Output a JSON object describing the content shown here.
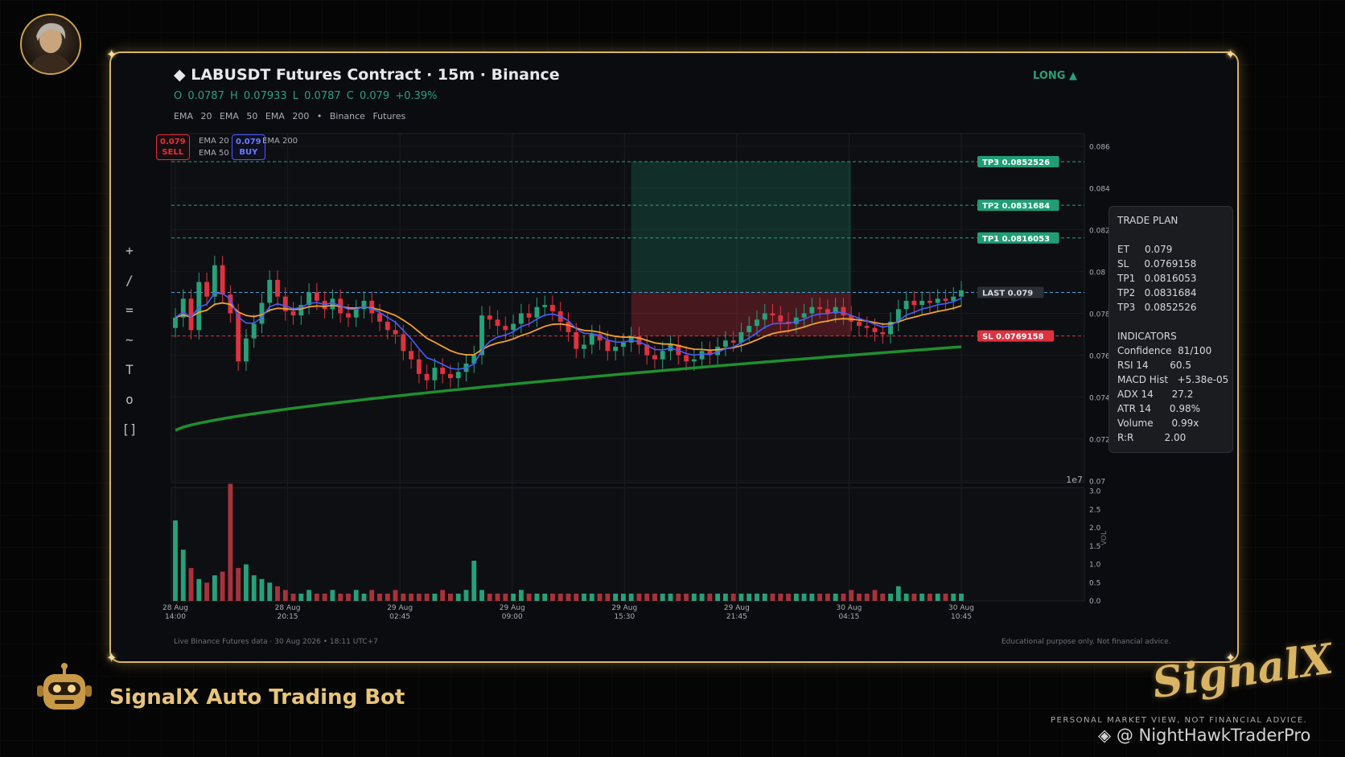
{
  "header": {
    "title": "◆  LABUSDT Futures Contract  ·  15m  ·  Binance",
    "ohlc": "O 0.0787   H 0.07933   L 0.0787   C 0.079   +0.39%",
    "indicators_line": "EMA 20   EMA 50   EMA 200   •   Binance Futures",
    "direction": "LONG ▲"
  },
  "toolbar": {
    "tools": [
      "+",
      "/",
      "=",
      "~",
      "T",
      "o",
      "[]"
    ]
  },
  "order_pills": {
    "sell_price": "0.079",
    "sell_label": "SELL",
    "buy_price": "0.079",
    "buy_label": "BUY"
  },
  "chart_legend": {
    "ema20": "EMA 20",
    "ema50": "EMA 50",
    "ema200": "EMA 200"
  },
  "levels": {
    "tp3": "TP3  0.0852526",
    "tp2": "TP2  0.0831684",
    "tp1": "TP1  0.0816053",
    "last": "LAST  0.079",
    "sl": "SL  0.0769158"
  },
  "trade_plan": {
    "title": "TRADE PLAN",
    "rows": [
      "ET     0.079",
      "SL     0.0769158",
      "TP1   0.0816053",
      "TP2   0.0831684",
      "TP3   0.0852526"
    ],
    "ind_title": "INDICATORS",
    "ind_rows": [
      "Confidence  81/100",
      "RSI 14       60.5",
      "MACD Hist   +5.38e-05",
      "ADX 14      27.2",
      "ATR 14      0.98%",
      "Volume      0.99x",
      "R:R          2.00"
    ]
  },
  "footer": {
    "left": "Live Binance Futures data   ·   30 Aug 2026 • 18:11 UTC+7",
    "right": "Educational purpose only. Not financial advice."
  },
  "branding": {
    "bot_name": "SignalX Auto Trading Bot",
    "logo_text": "SignalX",
    "tagline": "PERSONAL MARKET VIEW, NOT FINANCIAL ADVICE.",
    "watermark": "◈ @ NightHawkTraderPro"
  },
  "colors": {
    "up": "#26a17a",
    "down": "#e0313f",
    "ema20": "#4a5cff",
    "ema50": "#f2a12c",
    "ema200": "#1f8f2f",
    "gold": "#d9b463"
  },
  "chart_data": {
    "type": "candlestick",
    "price_axis": {
      "ticks": [
        "0.086",
        "0.084",
        "0.082",
        "0.08",
        "0.078",
        "0.076",
        "0.074",
        "0.072",
        "0.07"
      ],
      "ylim": [
        0.0699,
        0.0866
      ],
      "offset_label": "1e7"
    },
    "volume_axis": {
      "label": "VOL",
      "ticks": [
        "3.0",
        "2.5",
        "2.0",
        "1.5",
        "1.0",
        "0.5",
        "0.0"
      ],
      "ylim": [
        0,
        3.1
      ]
    },
    "time_ticks": [
      [
        "28 Aug",
        "14:00"
      ],
      [
        "28 Aug",
        "20:15"
      ],
      [
        "29 Aug",
        "02:45"
      ],
      [
        "29 Aug",
        "09:00"
      ],
      [
        "29 Aug",
        "15:30"
      ],
      [
        "29 Aug",
        "21:45"
      ],
      [
        "30 Aug",
        "04:15"
      ],
      [
        "30 Aug",
        "10:45"
      ]
    ],
    "levels": {
      "tp3": 0.0852526,
      "tp2": 0.0831684,
      "tp1": 0.0816053,
      "entry": 0.079,
      "sl": 0.0769158
    },
    "closes": [
      0.0778,
      0.0787,
      0.0772,
      0.0795,
      0.0788,
      0.0803,
      0.0789,
      0.078,
      0.0757,
      0.0768,
      0.0775,
      0.0785,
      0.0796,
      0.0788,
      0.0781,
      0.0779,
      0.0784,
      0.079,
      0.0786,
      0.0782,
      0.0787,
      0.078,
      0.0778,
      0.0782,
      0.0786,
      0.078,
      0.0776,
      0.0772,
      0.077,
      0.0762,
      0.0758,
      0.0751,
      0.0748,
      0.0754,
      0.0751,
      0.0749,
      0.0752,
      0.0756,
      0.076,
      0.0779,
      0.0777,
      0.0774,
      0.0772,
      0.0775,
      0.078,
      0.0778,
      0.0783,
      0.0784,
      0.0781,
      0.0776,
      0.0771,
      0.0763,
      0.0765,
      0.077,
      0.0767,
      0.0762,
      0.0764,
      0.0766,
      0.0769,
      0.0765,
      0.076,
      0.0758,
      0.0762,
      0.0765,
      0.076,
      0.0757,
      0.0758,
      0.0762,
      0.076,
      0.0764,
      0.0767,
      0.0766,
      0.0771,
      0.0774,
      0.0777,
      0.078,
      0.0779,
      0.0776,
      0.0775,
      0.0778,
      0.078,
      0.0783,
      0.0782,
      0.078,
      0.0783,
      0.0779,
      0.0776,
      0.0774,
      0.0773,
      0.0771,
      0.077,
      0.0776,
      0.0782,
      0.0786,
      0.0784,
      0.0786,
      0.0785,
      0.0787,
      0.0786,
      0.0788,
      0.0791
    ],
    "volumes": [
      2.2,
      1.4,
      0.9,
      0.6,
      0.5,
      0.7,
      0.8,
      3.2,
      0.9,
      1.0,
      0.7,
      0.6,
      0.5,
      0.4,
      0.3,
      0.2,
      0.2,
      0.3,
      0.2,
      0.2,
      0.3,
      0.2,
      0.2,
      0.3,
      0.2,
      0.3,
      0.2,
      0.2,
      0.3,
      0.2,
      0.2,
      0.2,
      0.2,
      0.2,
      0.3,
      0.2,
      0.2,
      0.3,
      1.1,
      0.3,
      0.2,
      0.2,
      0.2,
      0.2,
      0.3,
      0.2,
      0.2,
      0.2,
      0.2,
      0.2,
      0.2,
      0.2,
      0.2,
      0.2,
      0.2,
      0.2,
      0.2,
      0.2,
      0.2,
      0.2,
      0.2,
      0.2,
      0.2,
      0.2,
      0.2,
      0.2,
      0.2,
      0.2,
      0.2,
      0.2,
      0.2,
      0.2,
      0.2,
      0.2,
      0.2,
      0.2,
      0.2,
      0.2,
      0.2,
      0.2,
      0.2,
      0.2,
      0.2,
      0.2,
      0.2,
      0.2,
      0.3,
      0.2,
      0.2,
      0.3,
      0.2,
      0.2,
      0.4,
      0.2,
      0.2,
      0.2,
      0.2,
      0.2,
      0.2,
      0.2,
      0.2
    ]
  }
}
